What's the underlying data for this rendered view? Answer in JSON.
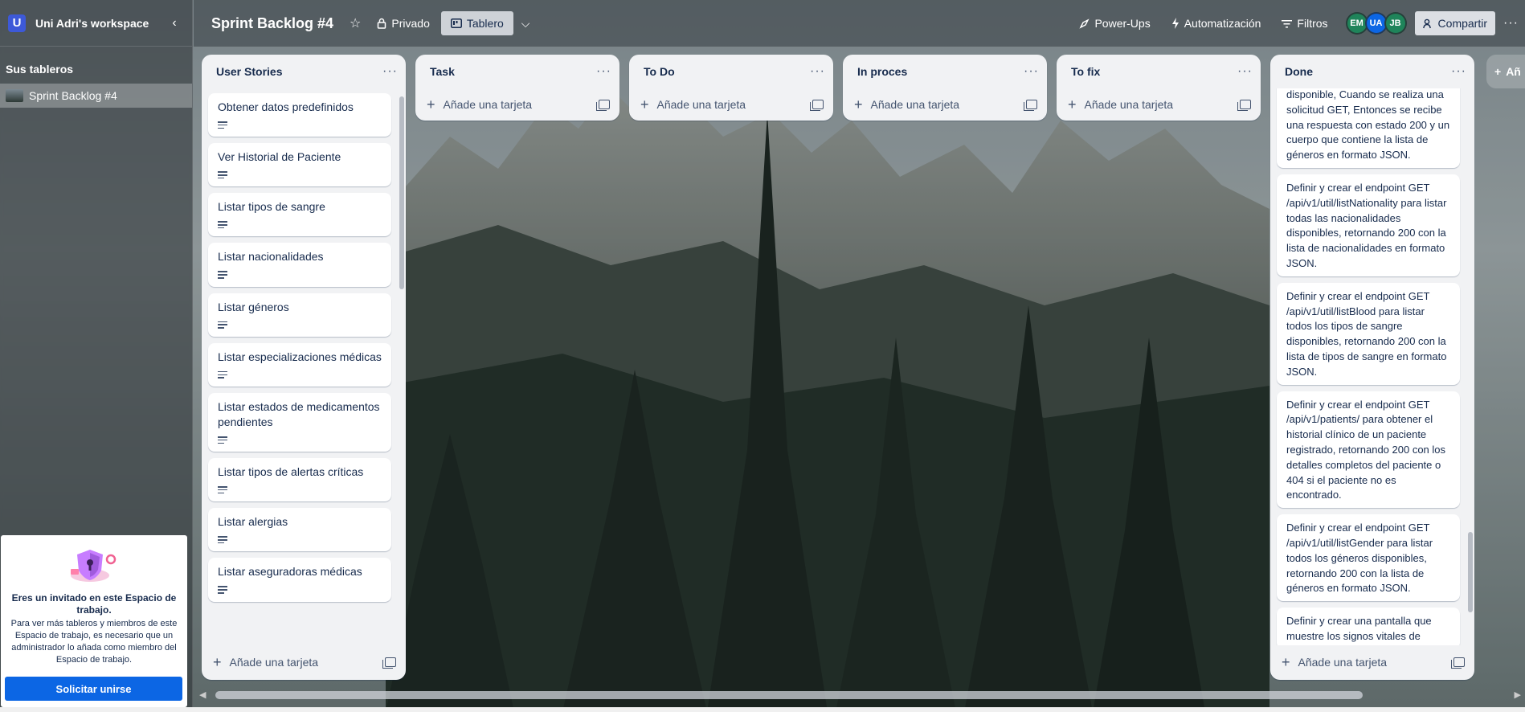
{
  "sidebar": {
    "workspace_initial": "U",
    "workspace_name": "Uni Adri's workspace",
    "boards_title": "Sus tableros",
    "boards": [
      {
        "label": "Sprint Backlog #4"
      }
    ],
    "invite": {
      "title": "Eres un invitado en este Espacio de trabajo.",
      "body": "Para ver más tableros y miembros de este Espacio de trabajo, es necesario que un administrador lo añada como miembro del Espacio de trabajo.",
      "button": "Solicitar unirse"
    }
  },
  "header": {
    "board_title": "Sprint Backlog #4",
    "visibility": "Privado",
    "view": "Tablero",
    "power_ups": "Power-Ups",
    "automation": "Automatización",
    "filters": "Filtros",
    "members": [
      {
        "initials": "EM",
        "color": "#1f845a"
      },
      {
        "initials": "UA",
        "color": "#0c66e4"
      },
      {
        "initials": "JB",
        "color": "#1f845a"
      }
    ],
    "share": "Compartir"
  },
  "add_card_label": "Añade una tarjeta",
  "lists": [
    {
      "title": "User Stories",
      "cards": [
        "Obtener datos predefinidos",
        "Ver Historial de Paciente",
        "Listar tipos de sangre",
        "Listar nacionalidades",
        "Listar géneros",
        "Listar especializaciones médicas",
        "Listar estados de medicamentos pendientes",
        "Listar tipos de alertas críticas",
        "Listar alergias",
        "Listar aseguradoras médicas"
      ]
    },
    {
      "title": "Task",
      "cards": []
    },
    {
      "title": "To Do",
      "cards": []
    },
    {
      "title": "In proces",
      "cards": []
    },
    {
      "title": "To fix",
      "cards": []
    },
    {
      "title": "Done",
      "cards": [
        "disponible, Cuando se realiza una solicitud GET, Entonces se recibe una respuesta con estado 200 y un cuerpo que contiene la lista de géneros en formato JSON.",
        "Definir y crear el endpoint GET /api/v1/util/listNationality para listar todas las nacionalidades disponibles, retornando 200 con la lista de nacionalidades en formato JSON.",
        "Definir y crear el endpoint GET /api/v1/util/listBlood para listar todos los tipos de sangre disponibles, retornando 200 con la lista de tipos de sangre en formato JSON.",
        "Definir y crear el endpoint GET /api/v1/patients/ para obtener el historial clínico de un paciente registrado, retornando 200 con los detalles completos del paciente o 404 si el paciente no es encontrado.",
        "Definir y crear el endpoint GET /api/v1/util/listGender para listar todos los géneros disponibles, retornando 200 con la lista de géneros en formato JSON.",
        "Definir y crear una pantalla que muestre los signos vitales de"
      ]
    }
  ],
  "peek_list_label": "Añ"
}
